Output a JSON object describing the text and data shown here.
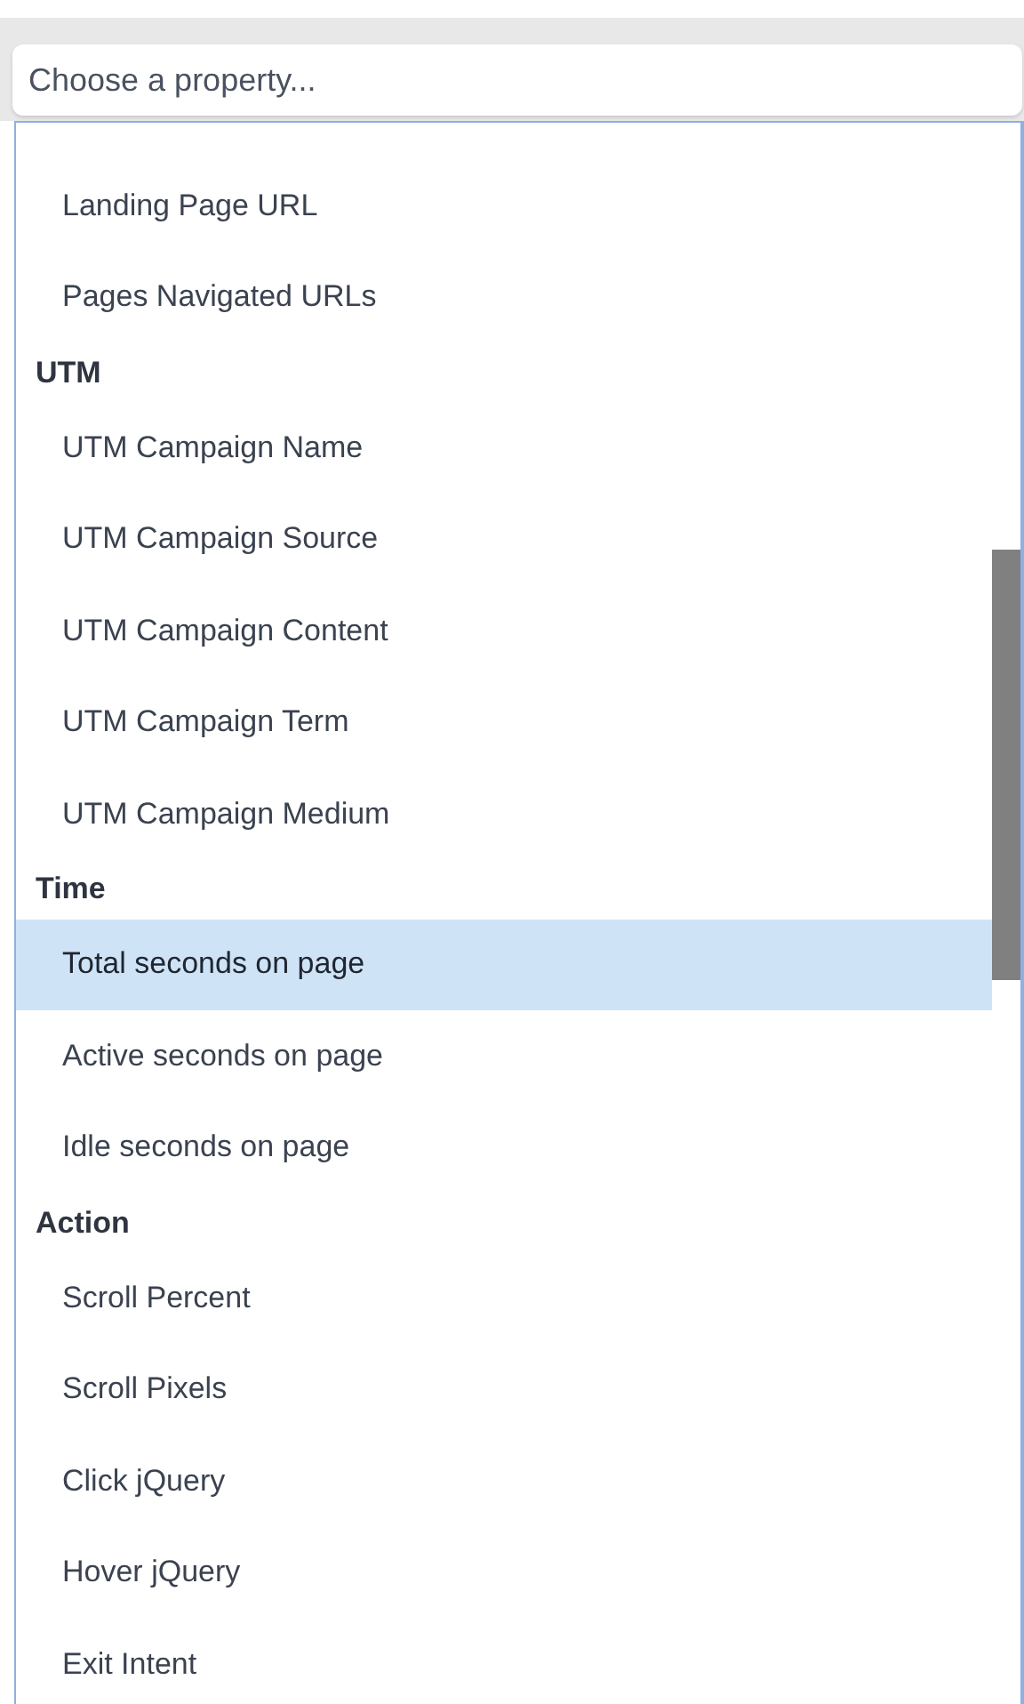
{
  "select": {
    "placeholder": "Choose a property..."
  },
  "groups": [
    {
      "items": [
        {
          "label": "Landing Page URL",
          "selected": false
        },
        {
          "label": "Pages Navigated URLs",
          "selected": false
        }
      ]
    },
    {
      "header": "UTM",
      "items": [
        {
          "label": "UTM Campaign Name",
          "selected": false
        },
        {
          "label": "UTM Campaign Source",
          "selected": false
        },
        {
          "label": "UTM Campaign Content",
          "selected": false
        },
        {
          "label": "UTM Campaign Term",
          "selected": false
        },
        {
          "label": "UTM Campaign Medium",
          "selected": false
        }
      ]
    },
    {
      "header": "Time",
      "items": [
        {
          "label": "Total seconds on page",
          "selected": true
        },
        {
          "label": "Active seconds on page",
          "selected": false
        },
        {
          "label": "Idle seconds on page",
          "selected": false
        }
      ]
    },
    {
      "header": "Action",
      "items": [
        {
          "label": "Scroll Percent",
          "selected": false
        },
        {
          "label": "Scroll Pixels",
          "selected": false
        },
        {
          "label": "Click jQuery",
          "selected": false
        },
        {
          "label": "Hover jQuery",
          "selected": false
        },
        {
          "label": "Exit Intent",
          "selected": false
        }
      ]
    }
  ]
}
